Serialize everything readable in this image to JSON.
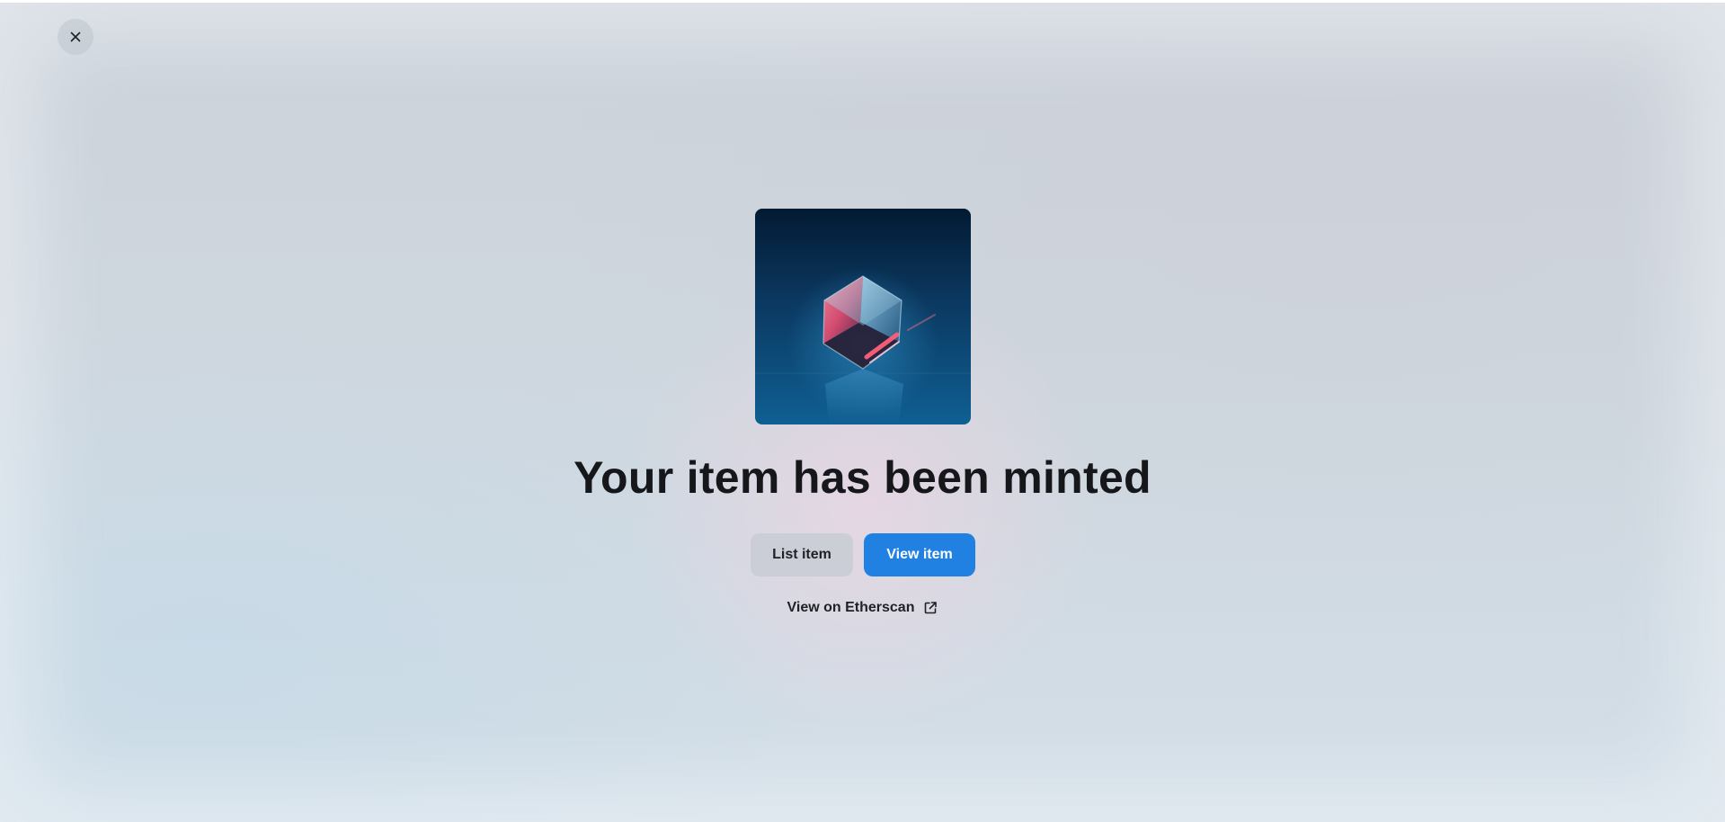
{
  "modal": {
    "close_icon": "close-icon",
    "image_alt": "Minted item image",
    "title": "Your item has been minted",
    "buttons": {
      "list_item": "List item",
      "view_item": "View item"
    },
    "etherscan": {
      "label": "View on Etherscan",
      "icon": "external-link-icon"
    }
  },
  "colors": {
    "primary": "#2081e2",
    "title_text": "#15171a"
  }
}
